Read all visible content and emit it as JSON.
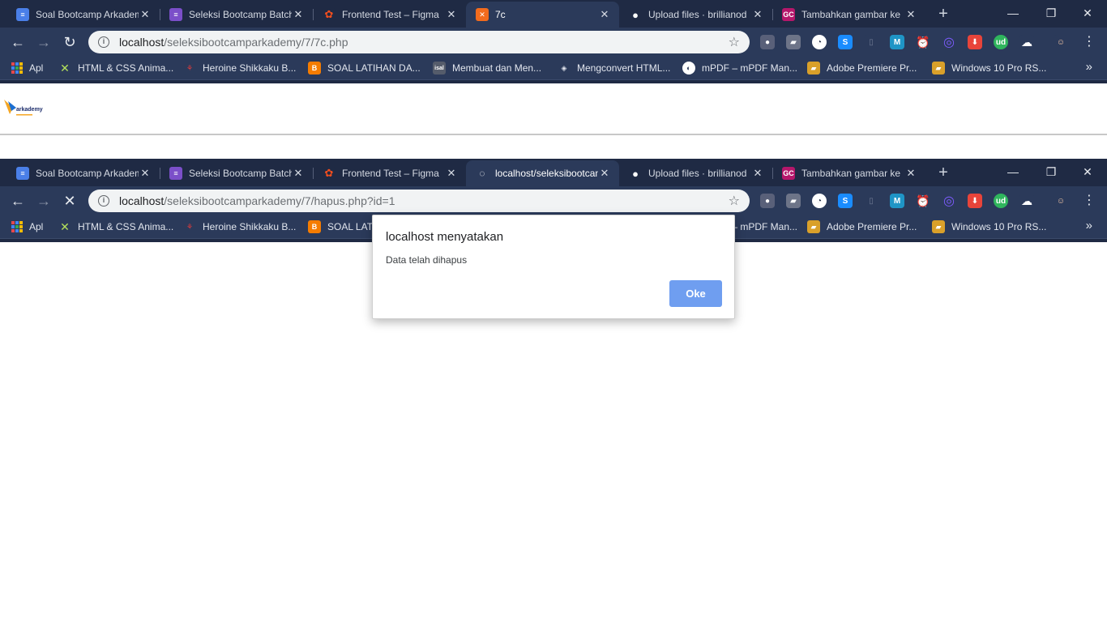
{
  "colors": {
    "frame": "#1f2a44",
    "toolbar": "#2b3a5a",
    "omnibox": "#f1f3f4",
    "ok_button": "#6f9ef0"
  },
  "tabs_top": [
    {
      "title": "Soal Bootcamp Arkademy",
      "icon": "google-docs-icon"
    },
    {
      "title": "Seleksi Bootcamp Batch",
      "icon": "google-forms-icon"
    },
    {
      "title": "Frontend Test – Figma",
      "icon": "figma-icon"
    },
    {
      "title": "7c",
      "icon": "xampp-icon"
    },
    {
      "title": "Upload files · brillianod",
      "icon": "github-icon"
    },
    {
      "title": "Tambahkan gambar ke",
      "icon": "gc-icon",
      "icon_text": "GC"
    }
  ],
  "tabs_bottom": [
    {
      "title": "Soal Bootcamp Arkademy",
      "icon": "google-docs-icon"
    },
    {
      "title": "Seleksi Bootcamp Batch",
      "icon": "google-forms-icon"
    },
    {
      "title": "Frontend Test – Figma",
      "icon": "figma-icon"
    },
    {
      "title": "localhost/seleksibootcamp",
      "icon": "loading-icon"
    },
    {
      "title": "Upload files · brillianod",
      "icon": "github-icon"
    },
    {
      "title": "Tambahkan gambar ke",
      "icon": "gc-icon",
      "icon_text": "GC"
    }
  ],
  "address_top": {
    "host": "localhost",
    "path": "/seleksibootcamparkademy/7/7c.php"
  },
  "address_bottom": {
    "host": "localhost",
    "path": "/seleksibootcamparkademy/7/hapus.php?id=1"
  },
  "bookmarks": {
    "apps": "Apl",
    "items": [
      {
        "label": "HTML & CSS Anima...",
        "icon": "star-x-icon"
      },
      {
        "label": "Heroine Shikkaku B...",
        "icon": "anime-icon"
      },
      {
        "label": "SOAL LATIHAN DA...",
        "icon": "blogger-icon"
      },
      {
        "label": "Membuat dan Men...",
        "icon": "site-icon",
        "icon_text": "isal"
      },
      {
        "label": "Mengconvert HTML...",
        "icon": "drop-icon"
      },
      {
        "label": "mPDF – mPDF Man...",
        "icon": "globe-icon"
      },
      {
        "label": "Adobe Premiere Pr...",
        "icon": "windows-folder-icon"
      },
      {
        "label": "Windows 10 Pro RS...",
        "icon": "windows-folder-icon"
      }
    ],
    "more": "»"
  },
  "extensions_icon_text": {
    "s": "S",
    "m": "M",
    "ud": "ud"
  },
  "logo": {
    "text": "arkademy"
  },
  "dialog": {
    "title": "localhost menyatakan",
    "message": "Data telah dihapus",
    "ok": "Oke"
  }
}
